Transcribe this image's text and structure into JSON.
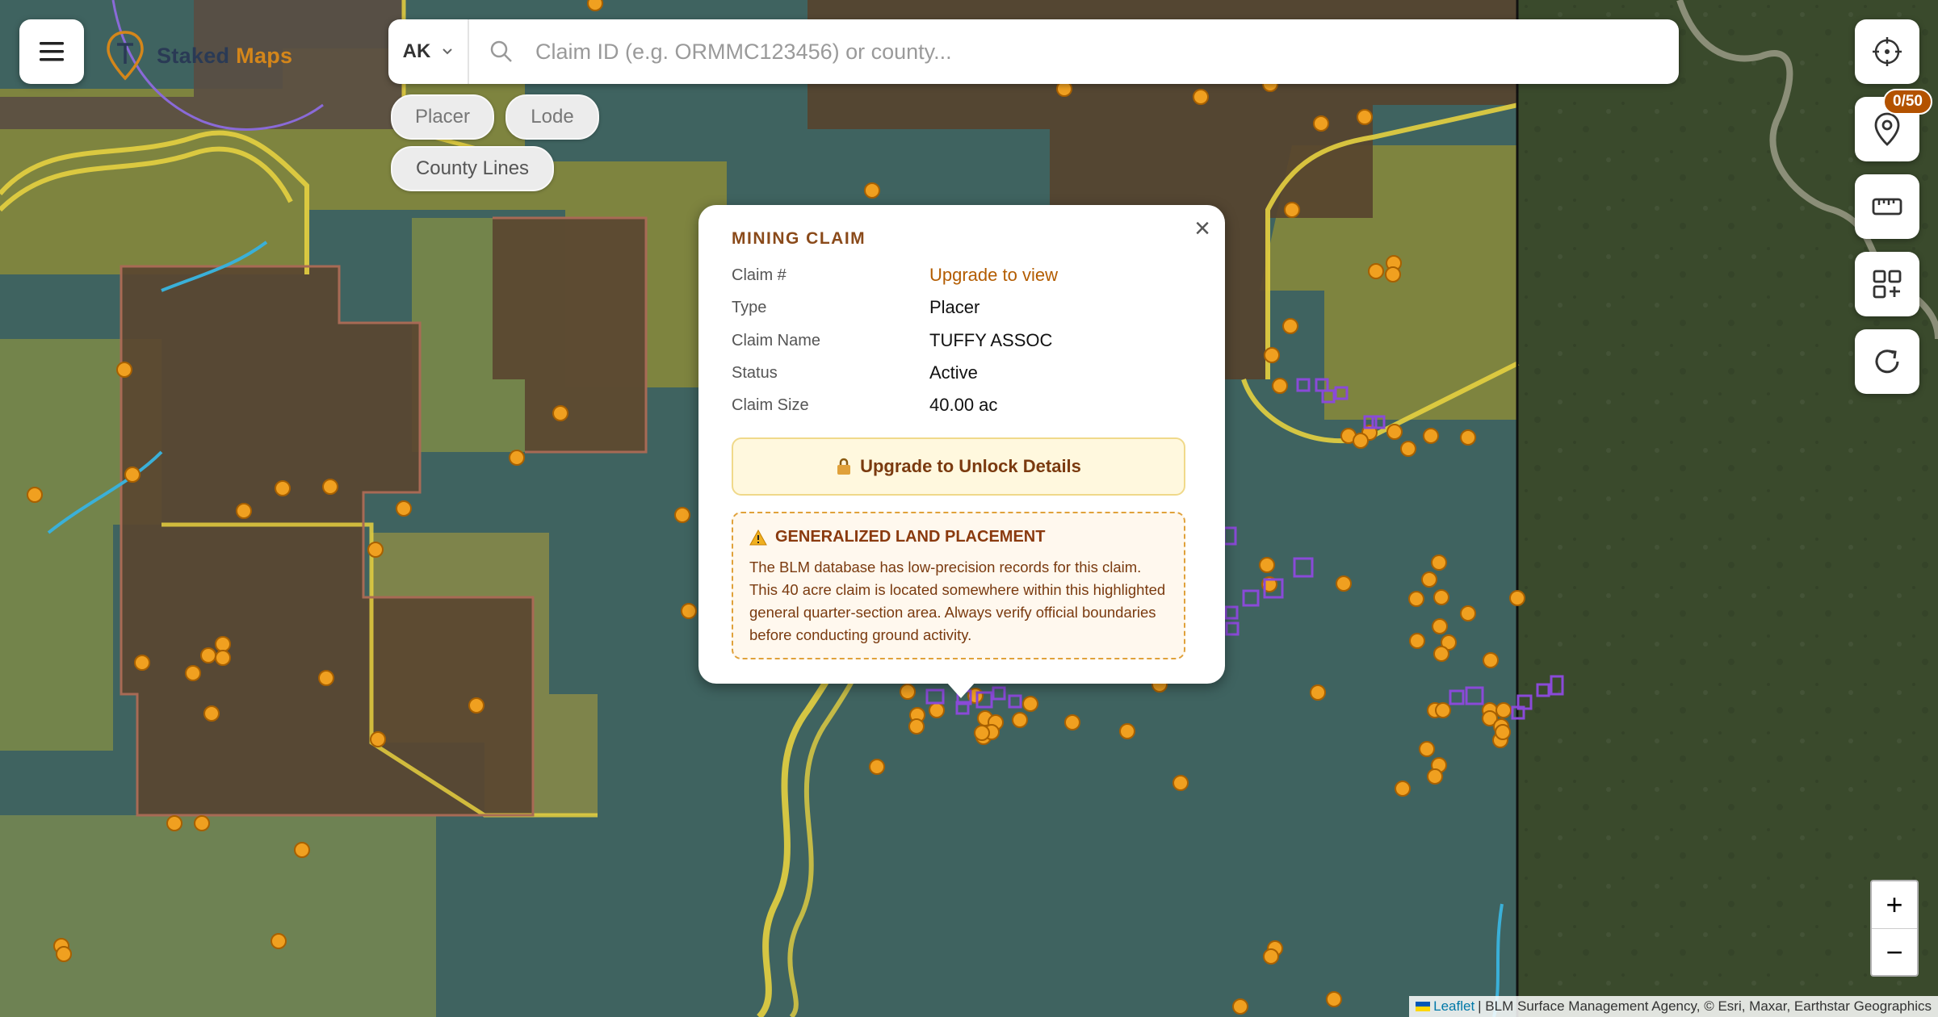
{
  "app": {
    "brand_first": "Staked",
    "brand_second": "Maps"
  },
  "search": {
    "state": "AK",
    "placeholder": "Claim ID (e.g. ORMMC123456) or county..."
  },
  "filters": [
    {
      "label": "Placer"
    },
    {
      "label": "Lode"
    },
    {
      "label": "County Lines"
    }
  ],
  "right_toolbar": {
    "buttons": [
      {
        "icon": "locate-crosshair-icon"
      },
      {
        "icon": "map-pin-icon"
      },
      {
        "icon": "ruler-icon"
      },
      {
        "icon": "layers-grid-icon"
      },
      {
        "icon": "refresh-icon"
      }
    ],
    "pin_badge": "0/50"
  },
  "zoom": {
    "in": "+",
    "out": "−"
  },
  "attribution": {
    "leaflet": "Leaflet",
    "rest": "| BLM Surface Management Agency, © Esri, Maxar, Earthstar Geographics"
  },
  "popup": {
    "title": "MINING CLAIM",
    "rows": [
      {
        "label": "Claim #",
        "value": "Upgrade to view"
      },
      {
        "label": "Type",
        "value": "Placer"
      },
      {
        "label": "Claim Name",
        "value": "TUFFY ASSOC"
      },
      {
        "label": "Status",
        "value": "Active"
      },
      {
        "label": "Claim Size",
        "value": "40.00 ac"
      }
    ],
    "unlock_button": "Upgrade to Unlock Details",
    "warning_title": "GENERALIZED LAND PLACEMENT",
    "warning_text": "The BLM database has low-precision records for this claim. This 40 acre claim is located somewhere within this highlighted general quarter-section area. Always verify official boundaries before conducting ground activity."
  },
  "colors": {
    "accent": "#d4861a",
    "claim_marker": "#f0a020",
    "lode_marker": "#8a4ad8",
    "popup_link": "#b35c00"
  }
}
